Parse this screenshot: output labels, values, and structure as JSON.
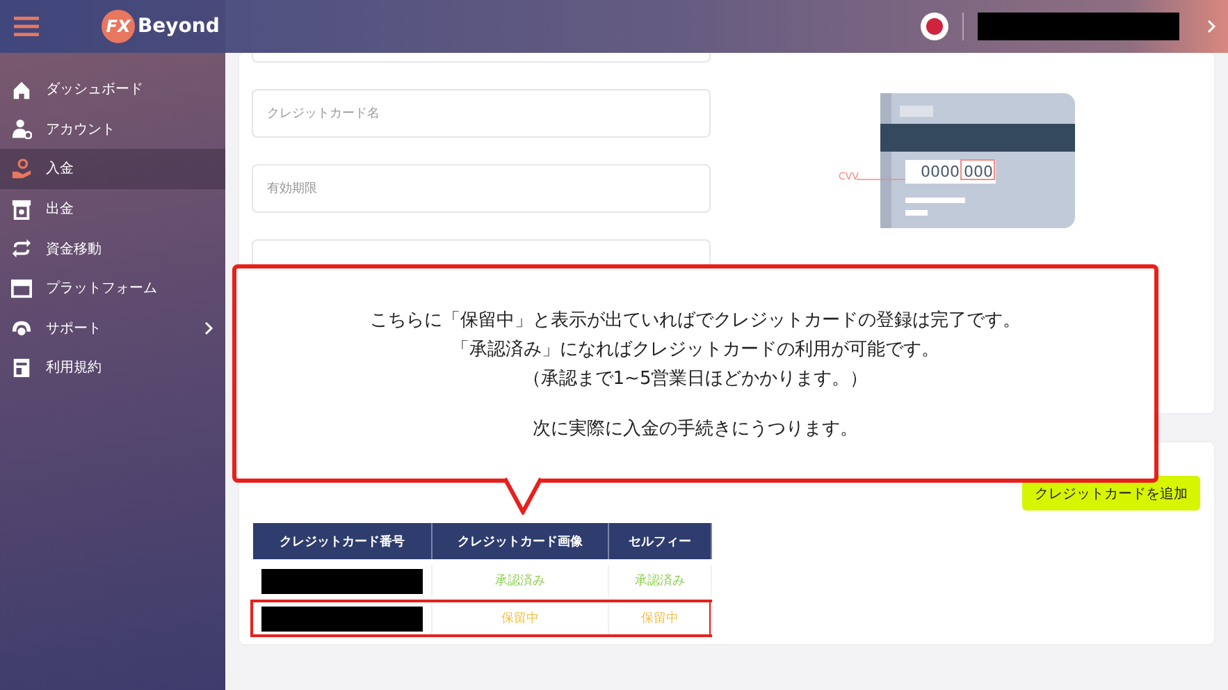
{
  "header": {
    "logo_mark": "FX",
    "logo_text": "Beyond"
  },
  "sidebar": {
    "items": [
      {
        "label": "ダッシュボード",
        "selected": false,
        "has_submenu": false
      },
      {
        "label": "アカウント",
        "selected": false,
        "has_submenu": false
      },
      {
        "label": "入金",
        "selected": true,
        "has_submenu": false
      },
      {
        "label": "出金",
        "selected": false,
        "has_submenu": false
      },
      {
        "label": "資金移動",
        "selected": false,
        "has_submenu": false
      },
      {
        "label": "プラットフォーム",
        "selected": false,
        "has_submenu": false
      },
      {
        "label": "サポート",
        "selected": false,
        "has_submenu": true
      },
      {
        "label": "利用規約",
        "selected": false,
        "has_submenu": false
      }
    ]
  },
  "form": {
    "fields": [
      {
        "placeholder": "クレジットカード名"
      },
      {
        "placeholder": "有効期限"
      }
    ],
    "card_image": {
      "label": "CVV",
      "number": "0000",
      "cvv": "000"
    }
  },
  "cards_list": {
    "add_button": "クレジットカードを追加",
    "table": {
      "columns": [
        "クレジットカード番号",
        "クレジットカード画像",
        "セルフィー"
      ],
      "rows": [
        {
          "highlighted": false,
          "cells": [
            {
              "kind": "redacted"
            },
            {
              "kind": "status",
              "text": "承認済み",
              "color": "#8ad14c"
            },
            {
              "kind": "status",
              "text": "承認済み",
              "color": "#8ad14c"
            }
          ]
        },
        {
          "highlighted": true,
          "cells": [
            {
              "kind": "redacted"
            },
            {
              "kind": "status",
              "text": "保留中",
              "color": "#efc04a"
            },
            {
              "kind": "status",
              "text": "保留中",
              "color": "#efc04a"
            }
          ]
        }
      ]
    }
  },
  "callout": {
    "paragraphs": [
      [
        "こちらに「保留中」と表示が出ていればでクレジットカードの登録は完了です。",
        "「承認済み」になればクレジットカードの利用が可能です。",
        "（承認まで1~5営業日ほどかかります。）"
      ],
      [
        "次に実際に入金の手続きにうつります。"
      ]
    ]
  }
}
